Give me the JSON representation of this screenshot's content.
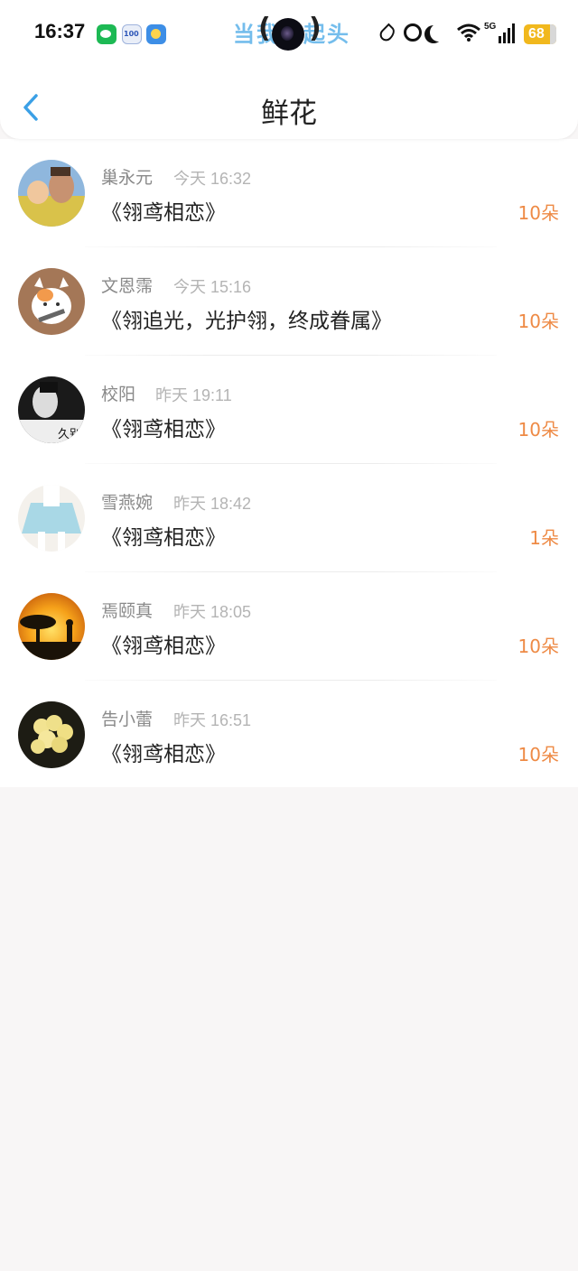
{
  "status_bar": {
    "time": "16:37",
    "island_text": "当我抬起头",
    "paren_left": "(",
    "paren_right": ")",
    "network": "5G",
    "battery": "68",
    "battery_color": "#f1b81d",
    "app_icons": [
      "wechat-icon",
      "100-app-icon",
      "weather-icon"
    ],
    "system_icons": [
      "dnd-drop-icon",
      "alarm-icon",
      "moon-icon",
      "wifi-icon",
      "signal-icon",
      "battery-icon"
    ]
  },
  "nav": {
    "title": "鲜花",
    "back_icon": "chevron-left-icon",
    "accent_color": "#3ba0e6"
  },
  "flowers": [
    {
      "name": "巢永元",
      "time": "今天 16:32",
      "content": "《翎鸢相恋》",
      "count": "10朵"
    },
    {
      "name": "文恩霈",
      "time": "今天 15:16",
      "content": "《翎追光，光护翎，终成眷属》",
      "count": "10朵"
    },
    {
      "name": "校阳",
      "time": "昨天 19:11",
      "content": "《翎鸢相恋》",
      "count": "10朵",
      "avatar_caption": "久别"
    },
    {
      "name": "雪燕婉",
      "time": "昨天 18:42",
      "content": "《翎鸢相恋》",
      "count": "1朵"
    },
    {
      "name": "焉颐真",
      "time": "昨天 18:05",
      "content": "《翎鸢相恋》",
      "count": "10朵"
    },
    {
      "name": "告小蕾",
      "time": "昨天 16:51",
      "content": "《翎鸢相恋》",
      "count": "10朵"
    }
  ],
  "colors": {
    "count": "#ee8a45",
    "name": "#8a8a8a",
    "time": "#b4b4b4",
    "background": "#f8f6f6"
  }
}
